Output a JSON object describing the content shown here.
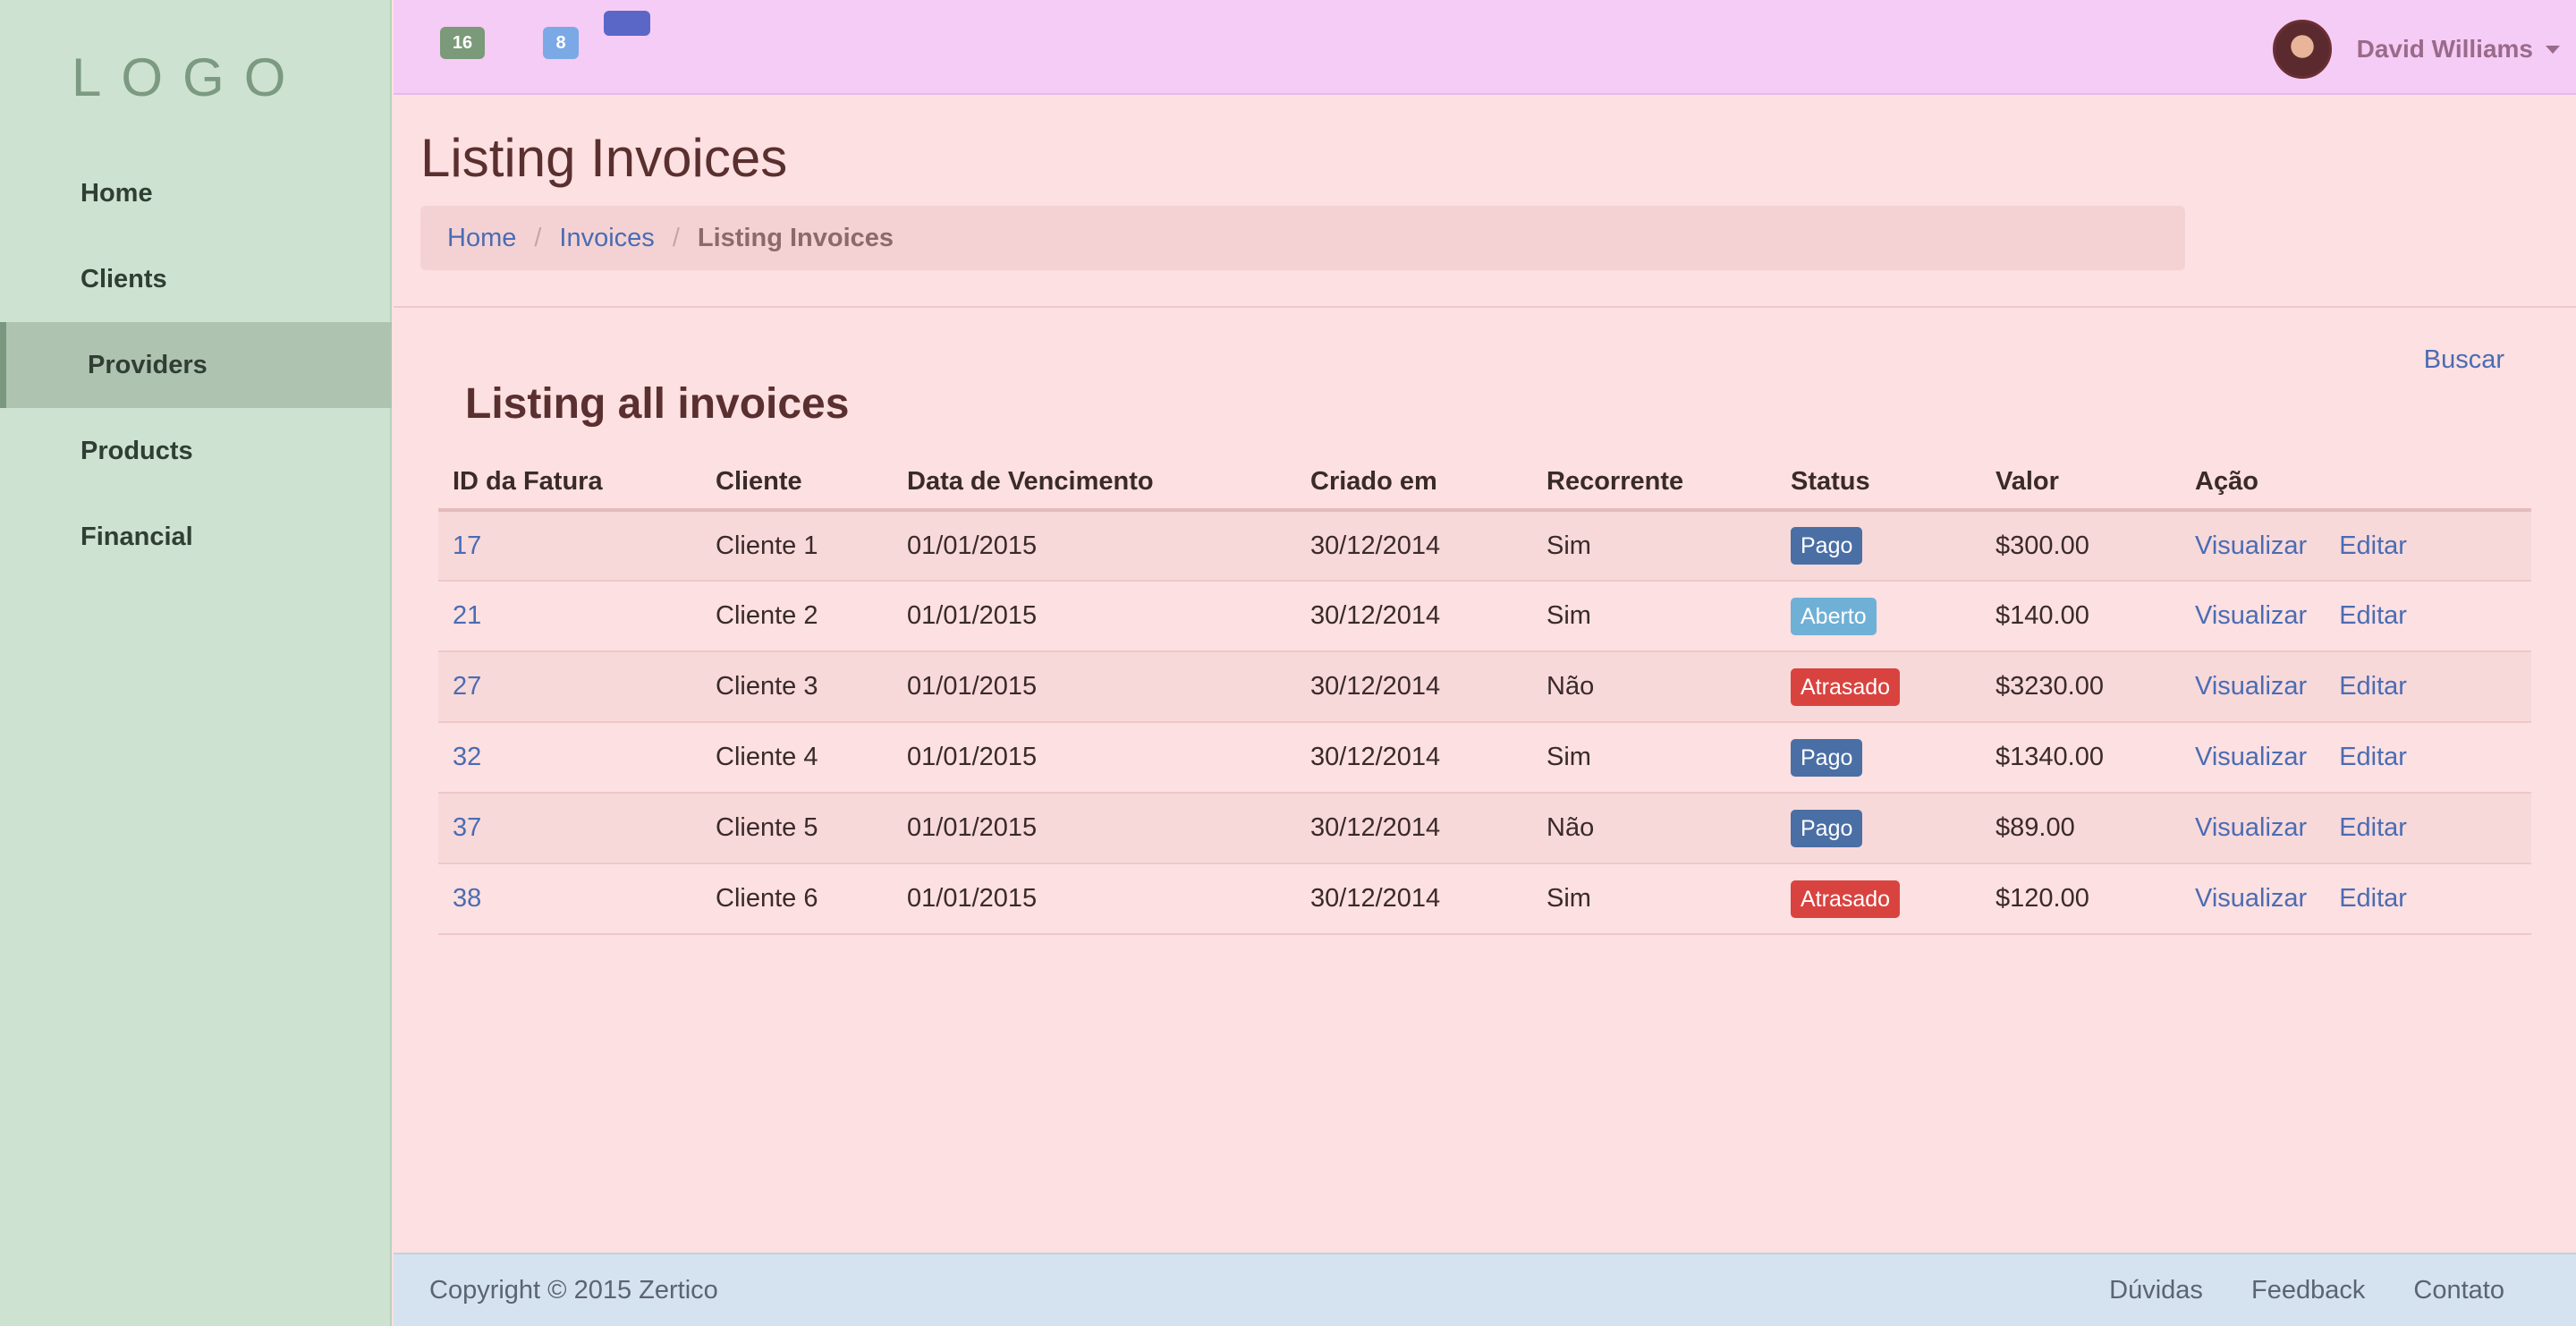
{
  "brand": {
    "logo": "LOGO"
  },
  "sidebar": {
    "items": [
      {
        "label": "Home"
      },
      {
        "label": "Clients"
      },
      {
        "label": "Providers"
      },
      {
        "label": "Products"
      },
      {
        "label": "Financial"
      }
    ]
  },
  "topbar": {
    "badge_green": "16",
    "badge_blue": "8",
    "badge_indigo": "",
    "user_name": "David Williams"
  },
  "page": {
    "title": "Listing Invoices",
    "breadcrumb": {
      "home": "Home",
      "invoices": "Invoices",
      "current": "Listing Invoices",
      "separator": "/"
    },
    "search_link": "Buscar",
    "section_title": "Listing all invoices"
  },
  "table": {
    "headers": [
      "ID da Fatura",
      "Cliente",
      "Data de Vencimento",
      "Criado em",
      "Recorrente",
      "Status",
      "Valor",
      "Ação"
    ],
    "action_view": "Visualizar",
    "action_edit": "Editar",
    "rows": [
      {
        "id": "17",
        "client": "Cliente 1",
        "due": "01/01/2015",
        "created": "30/12/2014",
        "recurring": "Sim",
        "status": "Pago",
        "value": "$300.00"
      },
      {
        "id": "21",
        "client": "Cliente 2",
        "due": "01/01/2015",
        "created": "30/12/2014",
        "recurring": "Sim",
        "status": "Aberto",
        "value": "$140.00"
      },
      {
        "id": "27",
        "client": "Cliente 3",
        "due": "01/01/2015",
        "created": "30/12/2014",
        "recurring": "Não",
        "status": "Atrasado",
        "value": "$3230.00"
      },
      {
        "id": "32",
        "client": "Cliente 4",
        "due": "01/01/2015",
        "created": "30/12/2014",
        "recurring": "Sim",
        "status": "Pago",
        "value": "$1340.00"
      },
      {
        "id": "37",
        "client": "Cliente 5",
        "due": "01/01/2015",
        "created": "30/12/2014",
        "recurring": "Não",
        "status": "Pago",
        "value": "$89.00"
      },
      {
        "id": "38",
        "client": "Cliente 6",
        "due": "01/01/2015",
        "created": "30/12/2014",
        "recurring": "Sim",
        "status": "Atrasado",
        "value": "$120.00"
      }
    ]
  },
  "status_colors": {
    "Pago": "#4a6fa5",
    "Aberto": "#6fb0d6",
    "Atrasado": "#d9433f"
  },
  "footer": {
    "copyright": "Copyright © 2015 Zertico",
    "links": [
      "Dúvidas",
      "Feedback",
      "Contato"
    ]
  }
}
